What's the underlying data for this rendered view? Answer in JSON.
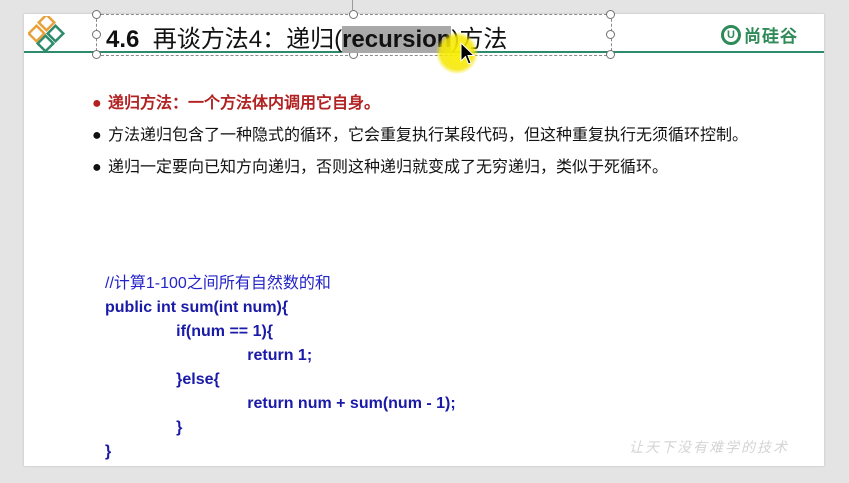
{
  "title": {
    "number": "4.6",
    "prefix": "再谈方法4：递归(",
    "highlight": "recursion",
    "suffix": ")方法"
  },
  "brand": {
    "symbol": "U",
    "name": "尚硅谷"
  },
  "bullets": [
    {
      "text": "递归方法：一个方法体内调用它自身。"
    },
    {
      "text": "方法递归包含了一种隐式的循环，它会重复执行某段代码，但这种重复执行无须循环控制。"
    },
    {
      "text": "递归一定要向已知方向递归，否则这种递归就变成了无穷递归，类似于死循环。"
    }
  ],
  "code": {
    "comment": "//计算1-100之间所有自然数的和",
    "lines": [
      "public int sum(int num){",
      "                if(num == 1){",
      "                                return 1;",
      "                }else{",
      "                                return num + sum(num - 1);",
      "                }",
      "}"
    ]
  },
  "watermark": "让天下没有难学的技术",
  "colors": {
    "accent": "#2e8b6a",
    "bullet_red": "#b22222",
    "code_blue": "#1a1aa8",
    "highlight_yellow": "#f5e600"
  }
}
